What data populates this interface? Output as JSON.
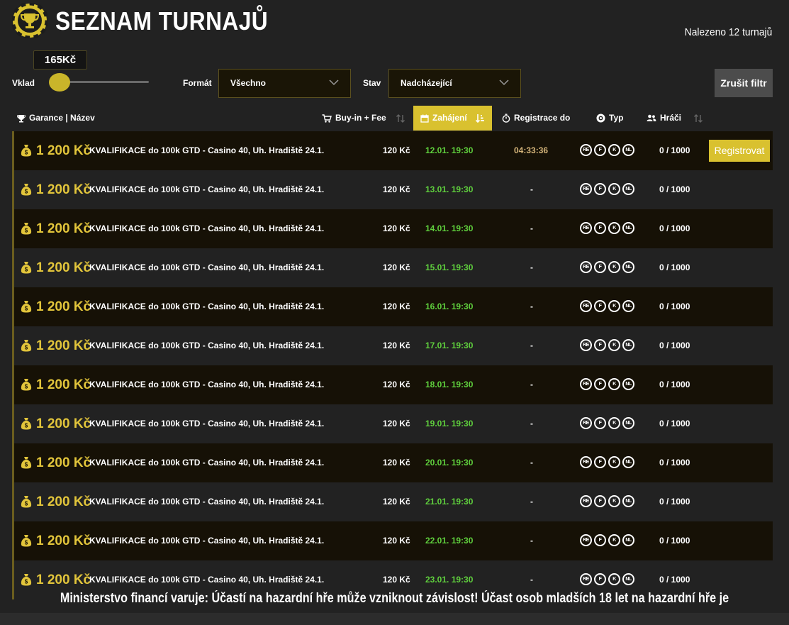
{
  "page": {
    "title": "SEZNAM TURNAJŮ",
    "found_text": "Nalezeno 12 turnajů",
    "logo_icon": "trophy-chip-icon",
    "accent": "#d9c12f",
    "gold_text": "#e2c53b",
    "date_color": "#5fcf3d"
  },
  "filters": {
    "deposit_label": "Vklad",
    "deposit_value": "165Kč",
    "deposit_slider_level": 0,
    "format_label": "Formát",
    "format_value": "Všechno",
    "state_label": "Stav",
    "state_value": "Nadcházející",
    "clear_label": "Zrušit filtr"
  },
  "columns": {
    "guarantee_name": "Garance | Název",
    "buyin": "Buy-in + Fee",
    "start": "Zahájení",
    "registration": "Registrace do",
    "type": "Typ",
    "players": "Hráči"
  },
  "rows": [
    {
      "amount": "1 200 Kč",
      "name": "KVALIFIKACE do 100k GTD - Casino 40, Uh. Hradiště 24.1.",
      "buyin": "120 Kč",
      "date": "12.01. 19:30",
      "reg": "04:33:36",
      "types": [
        "RE",
        "F",
        "K",
        "NL"
      ],
      "players": "0 / 1000",
      "action": "Registrovat"
    },
    {
      "amount": "1 200 Kč",
      "name": "KVALIFIKACE do 100k GTD - Casino 40, Uh. Hradiště 24.1.",
      "buyin": "120 Kč",
      "date": "13.01. 19:30",
      "reg": "-",
      "types": [
        "RE",
        "F",
        "K",
        "NL"
      ],
      "players": "0 / 1000"
    },
    {
      "amount": "1 200 Kč",
      "name": "KVALIFIKACE do 100k GTD - Casino 40, Uh. Hradiště 24.1.",
      "buyin": "120 Kč",
      "date": "14.01. 19:30",
      "reg": "-",
      "types": [
        "RE",
        "F",
        "K",
        "NL"
      ],
      "players": "0 / 1000"
    },
    {
      "amount": "1 200 Kč",
      "name": "KVALIFIKACE do 100k GTD - Casino 40, Uh. Hradiště 24.1.",
      "buyin": "120 Kč",
      "date": "15.01. 19:30",
      "reg": "-",
      "types": [
        "RE",
        "F",
        "K",
        "NL"
      ],
      "players": "0 / 1000"
    },
    {
      "amount": "1 200 Kč",
      "name": "KVALIFIKACE do 100k GTD - Casino 40, Uh. Hradiště 24.1.",
      "buyin": "120 Kč",
      "date": "16.01. 19:30",
      "reg": "-",
      "types": [
        "RE",
        "F",
        "K",
        "NL"
      ],
      "players": "0 / 1000"
    },
    {
      "amount": "1 200 Kč",
      "name": "KVALIFIKACE do 100k GTD - Casino 40, Uh. Hradiště 24.1.",
      "buyin": "120 Kč",
      "date": "17.01. 19:30",
      "reg": "-",
      "types": [
        "RE",
        "F",
        "K",
        "NL"
      ],
      "players": "0 / 1000"
    },
    {
      "amount": "1 200 Kč",
      "name": "KVALIFIKACE do 100k GTD - Casino 40, Uh. Hradiště 24.1.",
      "buyin": "120 Kč",
      "date": "18.01. 19:30",
      "reg": "-",
      "types": [
        "RE",
        "F",
        "K",
        "NL"
      ],
      "players": "0 / 1000"
    },
    {
      "amount": "1 200 Kč",
      "name": "KVALIFIKACE do 100k GTD - Casino 40, Uh. Hradiště 24.1.",
      "buyin": "120 Kč",
      "date": "19.01. 19:30",
      "reg": "-",
      "types": [
        "RE",
        "F",
        "K",
        "NL"
      ],
      "players": "0 / 1000"
    },
    {
      "amount": "1 200 Kč",
      "name": "KVALIFIKACE do 100k GTD - Casino 40, Uh. Hradiště 24.1.",
      "buyin": "120 Kč",
      "date": "20.01. 19:30",
      "reg": "-",
      "types": [
        "RE",
        "F",
        "K",
        "NL"
      ],
      "players": "0 / 1000"
    },
    {
      "amount": "1 200 Kč",
      "name": "KVALIFIKACE do 100k GTD - Casino 40, Uh. Hradiště 24.1.",
      "buyin": "120 Kč",
      "date": "21.01. 19:30",
      "reg": "-",
      "types": [
        "RE",
        "F",
        "K",
        "NL"
      ],
      "players": "0 / 1000"
    },
    {
      "amount": "1 200 Kč",
      "name": "KVALIFIKACE do 100k GTD - Casino 40, Uh. Hradiště 24.1.",
      "buyin": "120 Kč",
      "date": "22.01. 19:30",
      "reg": "-",
      "types": [
        "RE",
        "F",
        "K",
        "NL"
      ],
      "players": "0 / 1000"
    },
    {
      "amount": "1 200 Kč",
      "name": "KVALIFIKACE do 100k GTD - Casino 40, Uh. Hradiště 24.1.",
      "buyin": "120 Kč",
      "date": "23.01. 19:30",
      "reg": "-",
      "types": [
        "RE",
        "F",
        "K",
        "NL"
      ],
      "players": "0 / 1000"
    }
  ],
  "warning": "Ministerstvo financí varuje: Účastí na hazardní hře může vzniknout závislost! Účast osob mladších 18 let na hazardní hře je zakázána!"
}
